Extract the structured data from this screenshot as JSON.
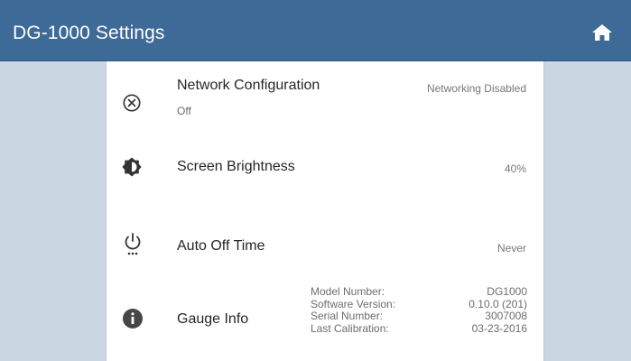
{
  "header": {
    "title": "DG-1000 Settings",
    "home_icon": "home-icon",
    "background_color": "#3e6a98"
  },
  "settings": {
    "network": {
      "icon": "close-circle-icon",
      "label": "Network Configuration",
      "sublabel": "Off",
      "value": "Networking Disabled"
    },
    "brightness": {
      "icon": "brightness-icon",
      "label": "Screen Brightness",
      "value": "40%"
    },
    "auto_off": {
      "icon": "power-timer-icon",
      "label": "Auto Off Time",
      "value": "Never"
    },
    "gauge_info": {
      "icon": "info-icon",
      "label": "Gauge Info",
      "details": [
        {
          "key": "Model Number:",
          "value": "DG1000"
        },
        {
          "key": "Software Version:",
          "value": "0.10.0 (201)"
        },
        {
          "key": "Serial Number:",
          "value": "3007008"
        },
        {
          "key": "Last Calibration:",
          "value": "03-23-2016"
        }
      ]
    }
  }
}
